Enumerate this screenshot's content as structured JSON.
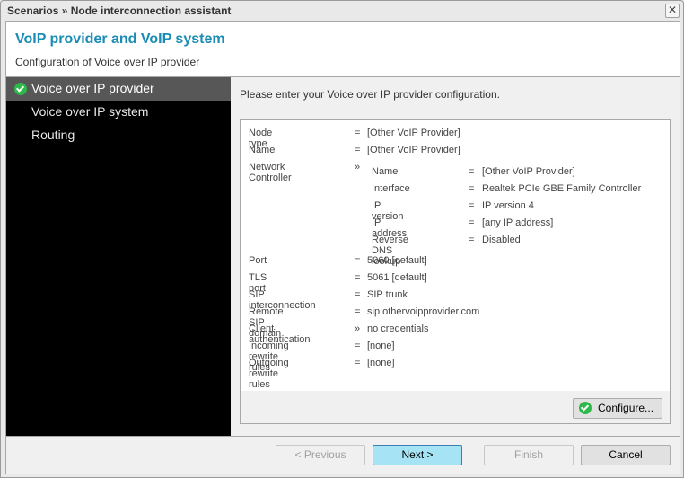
{
  "window": {
    "title": "Scenarios » Node interconnection assistant",
    "close_glyph": "✕"
  },
  "header": {
    "title": "VoIP provider and VoIP system",
    "subtitle": "Configuration of Voice over IP provider"
  },
  "sidebar": {
    "items": [
      {
        "label": "Voice over IP provider",
        "active": true,
        "completed": true
      },
      {
        "label": "Voice over IP system",
        "active": false
      },
      {
        "label": "Routing",
        "active": false
      }
    ]
  },
  "content": {
    "intro": "Please enter your Voice over IP provider configuration.",
    "summary": [
      {
        "key": "Node type",
        "op": "=",
        "value": "[Other VoIP Provider]"
      },
      {
        "key": "Name",
        "op": "=",
        "value": "[Other VoIP Provider]"
      },
      {
        "key": "Network Controller",
        "op": "»",
        "value": ""
      },
      {
        "key": "Port",
        "op": "=",
        "value": "5060 [default]"
      },
      {
        "key": "TLS port",
        "op": "=",
        "value": "5061 [default]"
      },
      {
        "key": "SIP interconnection",
        "op": "=",
        "value": "SIP trunk"
      },
      {
        "key": "Remote SIP domain",
        "op": "=",
        "value": "sip:othervoipprovider.com"
      },
      {
        "key": "Client authentication",
        "op": "»",
        "value": "no credentials"
      },
      {
        "key": "Incoming rewrite rules",
        "op": "=",
        "value": "[none]"
      },
      {
        "key": "Outgoing rewrite rules",
        "op": "=",
        "value": "[none]"
      }
    ],
    "network_controller": [
      {
        "key": "Name",
        "op": "=",
        "value": "[Other VoIP Provider]"
      },
      {
        "key": "Interface",
        "op": "=",
        "value": "Realtek PCIe GBE Family Controller"
      },
      {
        "key": "IP version",
        "op": "=",
        "value": "IP version 4"
      },
      {
        "key": "IP address",
        "op": "=",
        "value": "[any IP address]"
      },
      {
        "key": "Reverse DNS lookup",
        "op": "=",
        "value": "Disabled"
      }
    ],
    "configure_label": "Configure..."
  },
  "footer": {
    "previous": "< Previous",
    "next": "Next >",
    "finish": "Finish",
    "cancel": "Cancel"
  }
}
